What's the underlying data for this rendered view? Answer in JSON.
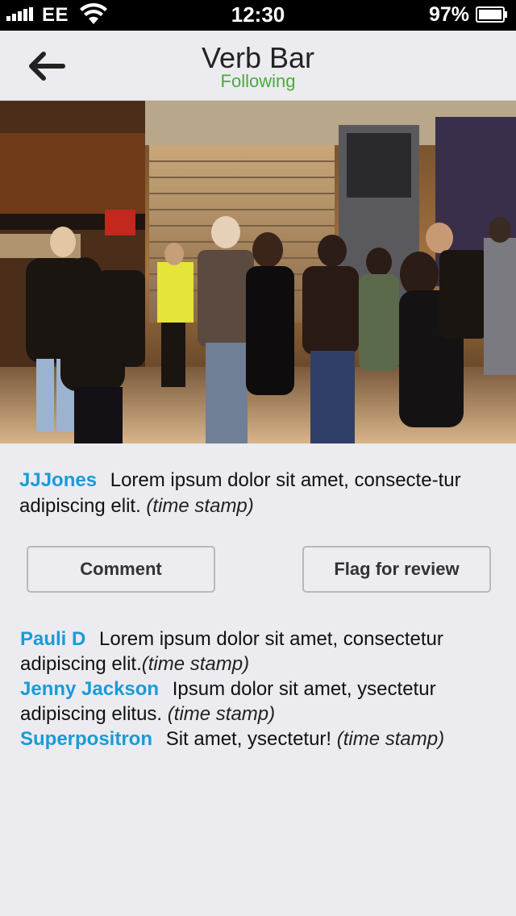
{
  "status_bar": {
    "carrier": "EE",
    "time": "12:30",
    "battery": "97%"
  },
  "nav": {
    "title": "Verb Bar",
    "subtitle": "Following",
    "back_icon": "arrow-left-icon"
  },
  "photo": {
    "description_icon": "photo-image"
  },
  "post": {
    "username": "JJJones",
    "text": "Lorem ipsum dolor sit amet, consecte-tur adipiscing elit.",
    "timestamp": "(time stamp)"
  },
  "actions": {
    "comment_label": "Comment",
    "flag_label": "Flag for review"
  },
  "comments": [
    {
      "username": "Pauli D",
      "text": "Lorem ipsum dolor sit amet, consectetur adipiscing elit.",
      "timestamp": "(time stamp)"
    },
    {
      "username": "Jenny Jackson",
      "text": "Ipsum dolor sit amet, ysectetur adipiscing elitus.",
      "timestamp": "(time stamp)"
    },
    {
      "username": "Superpositron",
      "text": "Sit amet, ysectetur!",
      "timestamp": "(time stamp)"
    }
  ],
  "colors": {
    "username": "#1a9bd7",
    "following": "#4caa3c",
    "background": "#ebebf0"
  }
}
